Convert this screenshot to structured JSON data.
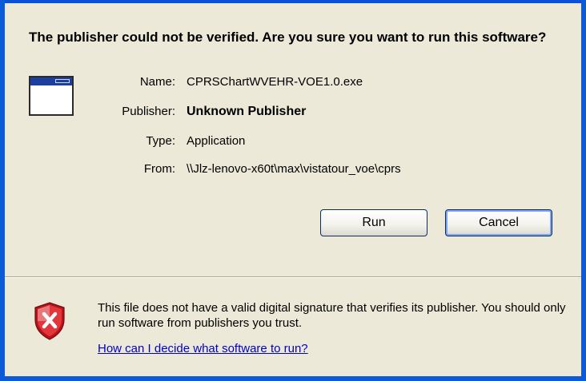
{
  "dialog": {
    "title": "The publisher could not be verified.  Are you sure you want to run this software?",
    "fields": {
      "name": {
        "label": "Name:",
        "value": "CPRSChartWVEHR-VOE1.0.exe"
      },
      "publisher": {
        "label": "Publisher:",
        "value": "Unknown Publisher"
      },
      "type": {
        "label": "Type:",
        "value": "Application"
      },
      "from": {
        "label": "From:",
        "value": "\\\\Jlz-lenovo-x60t\\max\\vistatour_voe\\cprs"
      }
    },
    "buttons": {
      "run": "Run",
      "cancel": "Cancel"
    },
    "warning": {
      "text": "This file does not have a valid digital signature that verifies its publisher.  You should only run software from publishers you trust.",
      "link": "How can I decide what software to run?"
    },
    "icons": {
      "app": "application-window-icon",
      "security": "security-shield-icon"
    },
    "colors": {
      "window_border": "#0d5ad8",
      "dialog_bg": "#ece9d8",
      "link": "#0000cc",
      "shield_red": "#d8262b"
    }
  }
}
